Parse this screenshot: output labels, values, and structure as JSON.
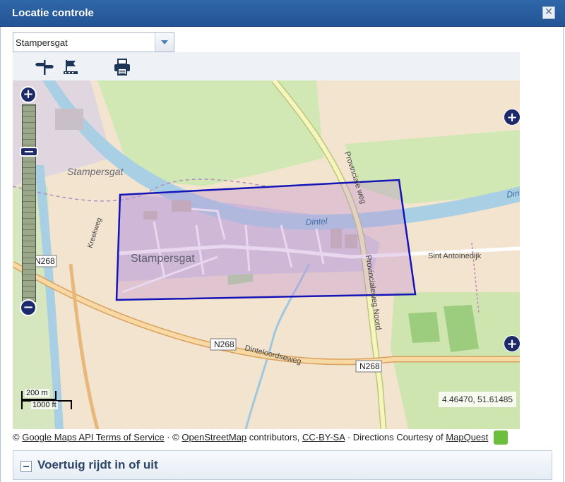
{
  "window": {
    "title": "Locatie controle",
    "close_icon": "close-icon"
  },
  "location_select": {
    "value": "Stampersgat"
  },
  "toolbar": {
    "icons": [
      "signpost-icon",
      "flag-icon",
      "printer-icon"
    ]
  },
  "map": {
    "labels": {
      "stampersgat_top": "Stampersgat",
      "stampersgat_main": "Stampersgat",
      "dintel": "Dintel",
      "dintel_right": "Dintel",
      "provinciale_weg": "Provinciale weg",
      "provincialeweg_noord": "Provincialeweg Noord",
      "sint_antoinedijk": "Sint Antoinedijk",
      "dinteloordseweg": "Dinteloordseweg",
      "kreekweg": "Kreekweg",
      "n268_left": "N268",
      "n268_mid": "N268",
      "n268_right": "N268"
    },
    "scale": {
      "metric": "200 m",
      "imperial": "1000 ft"
    },
    "coordinates": "4.46470, 51.61485",
    "zoom": {
      "plus": "+",
      "minus": "−"
    },
    "selection_color": "#1414b8"
  },
  "attribution": {
    "copyright1": "©",
    "google_link": "Google Maps API Terms of Service",
    "sep1": "·",
    "copyright2": "©",
    "osm_link": "OpenStreetMap",
    "contributors": "contributors,",
    "license_link": "CC-BY-SA",
    "sep2": "·",
    "directions": "Directions Courtesy of",
    "mapquest_link": "MapQuest"
  },
  "panel": {
    "title": "Voertuig rijdt in of uit"
  }
}
